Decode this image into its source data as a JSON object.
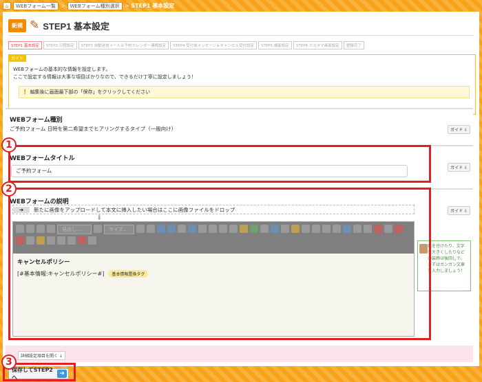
{
  "breadcrumb": {
    "home_icon": "home-icon",
    "items": [
      "WEBフォーム一覧",
      "WEBフォーム種別選択"
    ],
    "current": "STEP1 基本設定",
    "separator": ">"
  },
  "header": {
    "badge": "新規",
    "title": "STEP1 基本設定",
    "icon": "pencil-icon"
  },
  "steps": [
    "STEP1 基本設定",
    "STEP2 日程設定",
    "STEP3 自動送信メール＆予約カレンダー連携設定",
    "STEP4 受付後メッセージ＆キャンセル受付設定",
    "STEP5 機能設定",
    "STEP6 カスタマ画面設定",
    "登録完了"
  ],
  "guide": {
    "tab": "ガイド",
    "line1": "WEBフォームの基本的な情報を設定します。",
    "line2": "ここで設定する情報は大事な項目ばかりなので、できるだけ丁寧に設定しましょう！",
    "note": "編集後に画面最下部の「保存」をクリックしてください"
  },
  "sections": {
    "type": {
      "title": "WEBフォーム種別",
      "value": "ご予約フォーム 日時を第二希望までヒアリングするタイプ（一般向け）",
      "guide_label": "ガイド ⇩"
    },
    "title_field": {
      "title": "WEBフォームタイトル",
      "value": "ご予約フォーム",
      "guide_label": "ガイド ⇩"
    },
    "description": {
      "title": "WEBフォームの説明",
      "guide_label": "ガイド ⇩",
      "drop_text": "新たに画像をアップロードして本文に挿入したい場合はここに画像ファイルをドロップ",
      "select_heading": "見出し...",
      "select_size": "サイズ...",
      "editor_title": "キャンセルポリシー",
      "editor_line": "[#基本情報:キャンセルポリシー#]",
      "tag": "基本情報置換タグ"
    }
  },
  "hint": "色を付けたり、文字を大きくしたりなどの装飾は後回しで、まずはガンガン文章を入力しましょう！",
  "advanced_button": "詳細設定項目を開く ↓",
  "save_button": "保存してSTEP2へ",
  "callouts": [
    "1",
    "2",
    "3"
  ],
  "colors": {
    "accent_orange": "#f7a21a",
    "callout_red": "#e02020",
    "save_arrow_blue": "#3a9ad9"
  }
}
